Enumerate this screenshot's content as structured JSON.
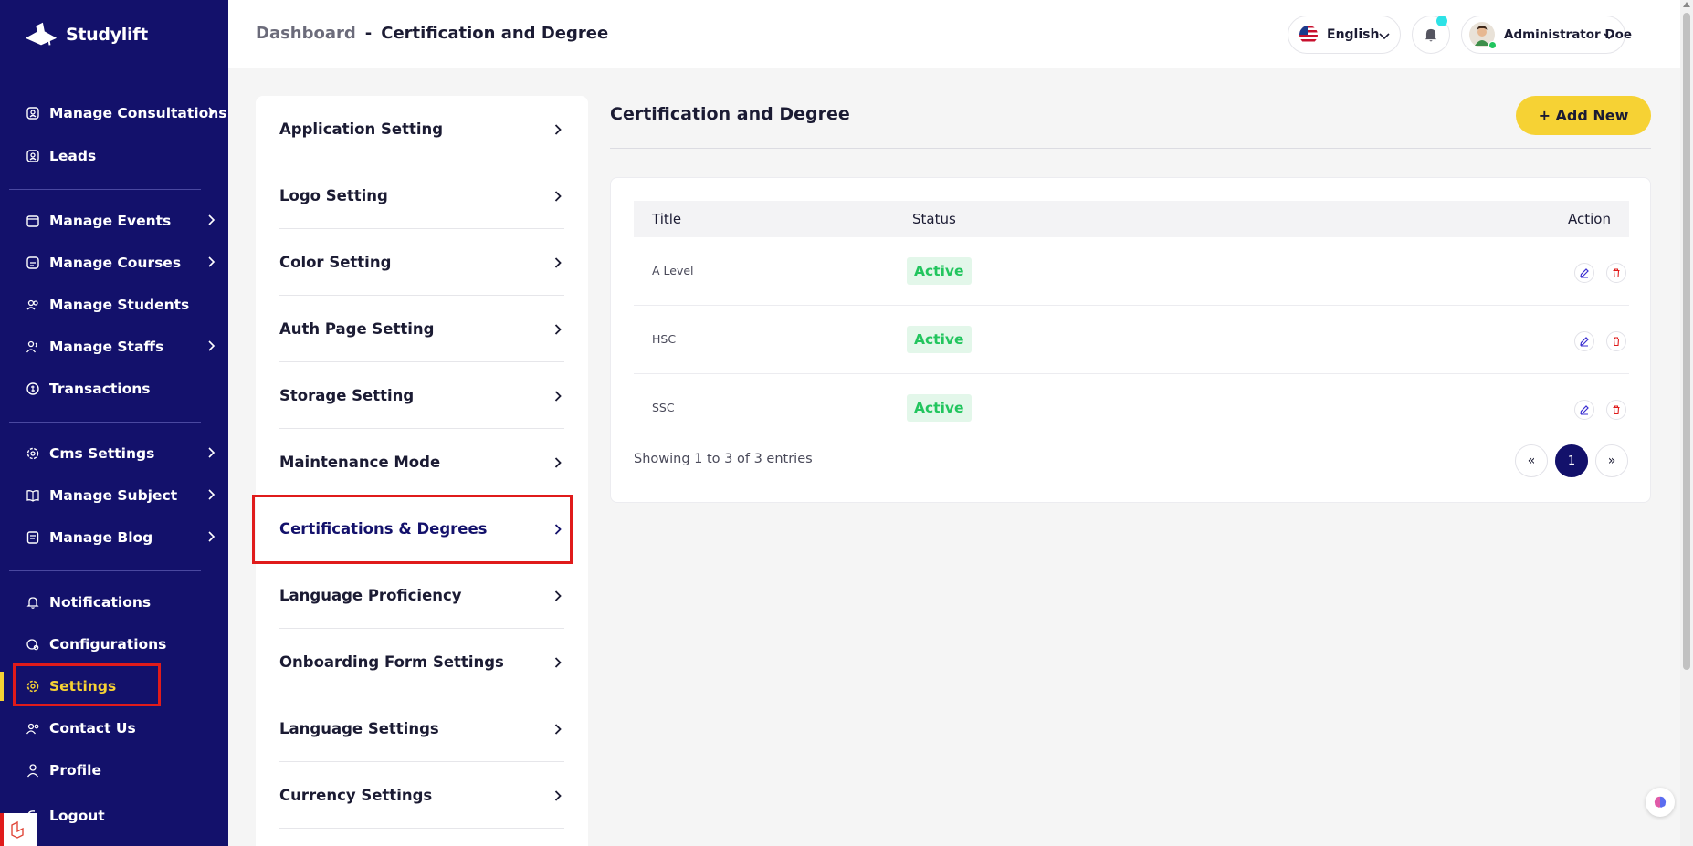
{
  "brand": {
    "name": "Studylift"
  },
  "sidebar": {
    "items": [
      {
        "label": "Manage Consultations",
        "icon": "user-badge-icon",
        "chevron": true
      },
      {
        "label": "Leads",
        "icon": "user-badge-icon",
        "chevron": false
      },
      {
        "label": "Manage Events",
        "icon": "calendar-icon",
        "chevron": true
      },
      {
        "label": "Manage Courses",
        "icon": "course-icon",
        "chevron": true
      },
      {
        "label": "Manage Students",
        "icon": "students-icon",
        "chevron": false
      },
      {
        "label": "Manage Staffs",
        "icon": "staff-icon",
        "chevron": true
      },
      {
        "label": "Transactions",
        "icon": "transactions-icon",
        "chevron": false
      },
      {
        "label": "Cms Settings",
        "icon": "cms-gear-icon",
        "chevron": true
      },
      {
        "label": "Manage Subject",
        "icon": "book-icon",
        "chevron": true
      },
      {
        "label": "Manage Blog",
        "icon": "blog-icon",
        "chevron": true
      },
      {
        "label": "Notifications",
        "icon": "bell-icon",
        "chevron": false
      },
      {
        "label": "Configurations",
        "icon": "config-icon",
        "chevron": false
      },
      {
        "label": "Settings",
        "icon": "gear-icon",
        "chevron": false,
        "active": true
      },
      {
        "label": "Contact Us",
        "icon": "contact-icon",
        "chevron": false
      },
      {
        "label": "Profile",
        "icon": "profile-icon",
        "chevron": false
      },
      {
        "label": "Logout",
        "icon": "logout-icon",
        "chevron": false
      }
    ]
  },
  "header": {
    "breadcrumb_root": "Dashboard",
    "breadcrumb_sep": "-",
    "breadcrumb_current": "Certification and Degree",
    "language": "English",
    "user_name": "Administrator Doe"
  },
  "settings_menu": {
    "items": [
      {
        "label": "Application Setting"
      },
      {
        "label": "Logo Setting"
      },
      {
        "label": "Color Setting"
      },
      {
        "label": "Auth Page Setting"
      },
      {
        "label": "Storage Setting"
      },
      {
        "label": "Maintenance Mode"
      },
      {
        "label": "Certifications & Degrees",
        "active": true
      },
      {
        "label": "Language Proficiency"
      },
      {
        "label": "Onboarding Form Settings"
      },
      {
        "label": "Language Settings"
      },
      {
        "label": "Currency Settings"
      }
    ]
  },
  "main": {
    "title": "Certification and Degree",
    "add_button": "+ Add New",
    "table": {
      "headers": {
        "title": "Title",
        "status": "Status",
        "action": "Action"
      },
      "rows": [
        {
          "title": "A Level",
          "status": "Active"
        },
        {
          "title": "HSC",
          "status": "Active"
        },
        {
          "title": "SSC",
          "status": "Active"
        }
      ]
    },
    "showing": "Showing 1 to 3 of 3 entries",
    "pagination": {
      "prev": "«",
      "current": "1",
      "next": "»"
    }
  },
  "colors": {
    "sidebar_bg": "#13116b",
    "accent_yellow": "#f6d234",
    "status_green": "#22c55e",
    "highlight_red": "#e01b1b"
  }
}
